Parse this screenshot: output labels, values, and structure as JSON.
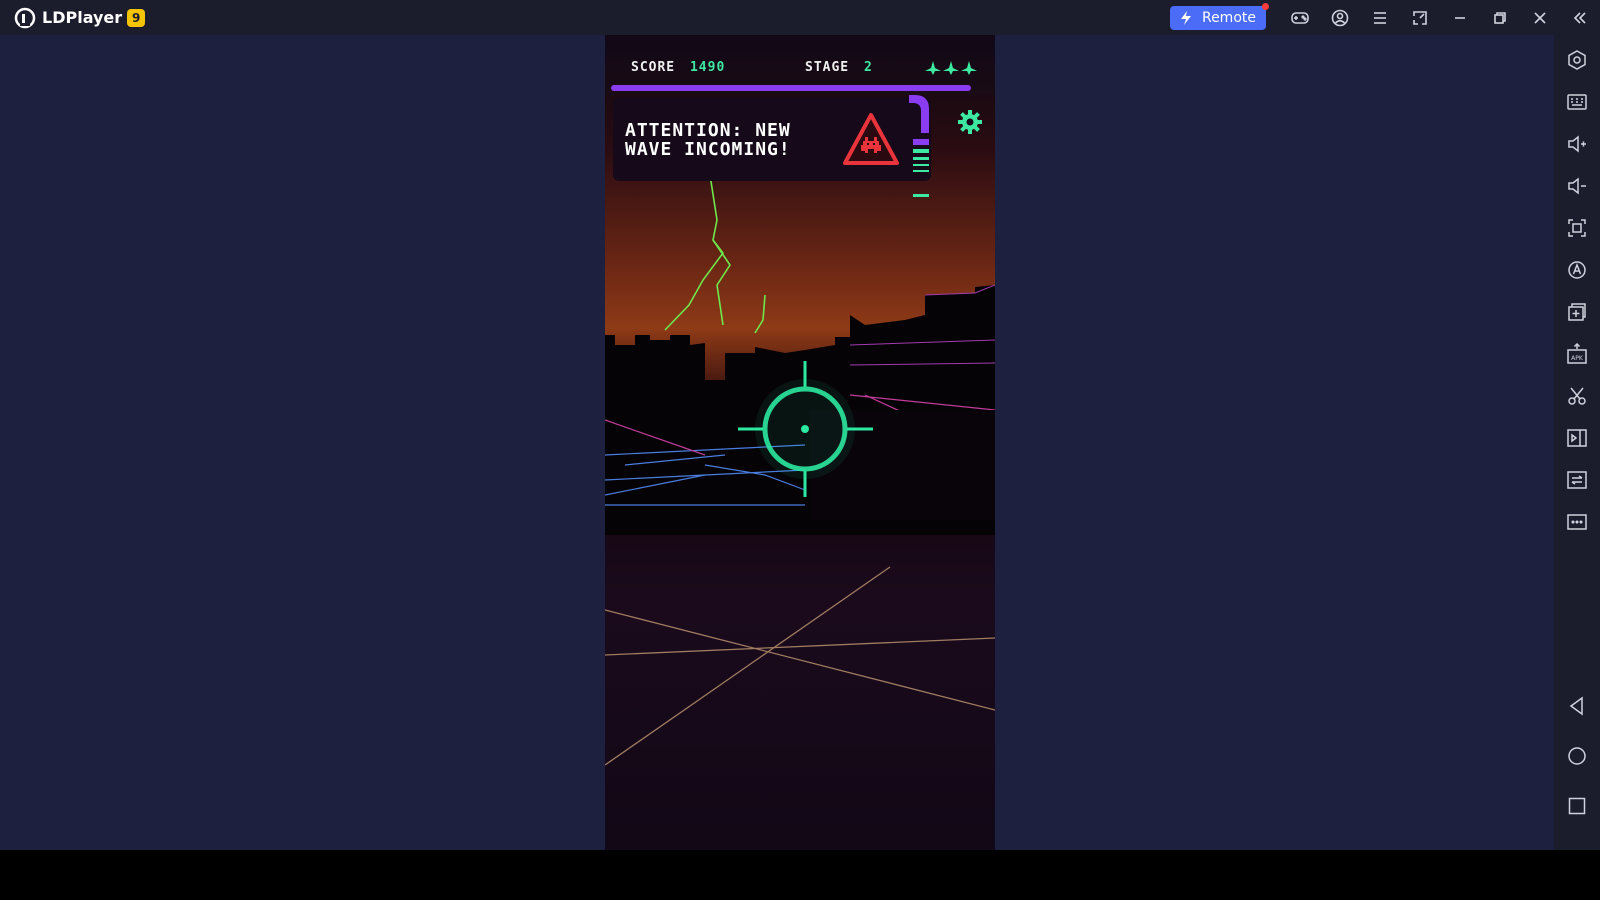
{
  "app": {
    "name": "LDPlayer",
    "version": "9"
  },
  "titlebar": {
    "remote_label": "Remote"
  },
  "game": {
    "score_label": "SCORE",
    "score_value": "1490",
    "stage_label": "STAGE",
    "stage_value": "2",
    "lives": 3,
    "alert_line1": "ATTENTION: NEW",
    "alert_line2": "WAVE INCOMING!"
  },
  "colors": {
    "accent": "#3de8a0",
    "purple": "#8a3cf0",
    "alert": "#e8343a",
    "remote": "#4a6cf7",
    "badge": "#f5c400"
  }
}
